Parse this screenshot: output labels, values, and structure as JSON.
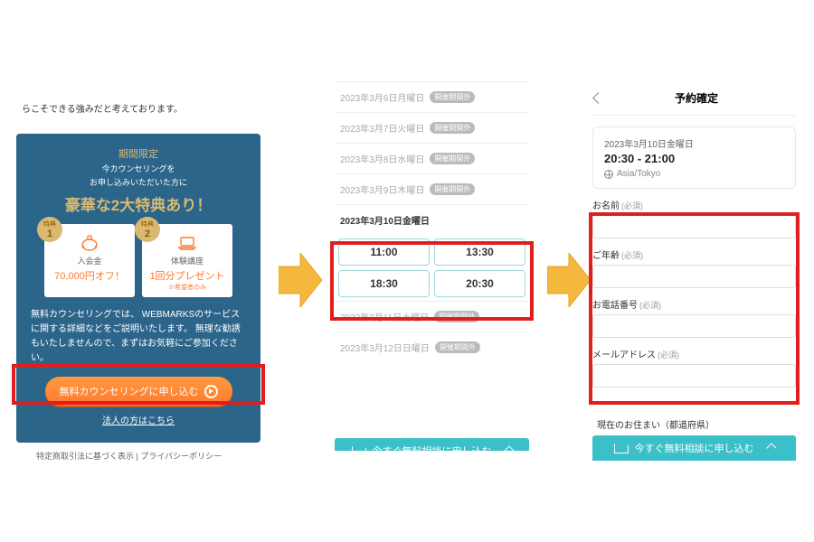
{
  "intro": "らこそできる強みだと考えております。",
  "promo": {
    "eyebrow": "期間限定",
    "sub1": "今カウンセリングを",
    "sub2": "お申し込みいただいた方に",
    "title": "豪華な2大特典あり！",
    "bonus1": {
      "rank": "1",
      "rank_label": "特典",
      "label": "入会金",
      "main": "70,000円オフ！"
    },
    "bonus2": {
      "rank": "2",
      "rank_label": "特典",
      "label": "体験講座",
      "main": "1回分プレゼント",
      "note": "※希望者のみ"
    },
    "body": "無料カウンセリングでは、\nWEBMARKSのサービスに関する詳細などをご説明いたします。\n無理な勧誘もいたしませんので、まずはお気軽にご参加ください。",
    "cta": "無料カウンセリングに申し込む",
    "corp_link": "法人の方はこちら"
  },
  "footer": {
    "tokusho": "特定商取引法に基づく表示",
    "sep": " | ",
    "privacy": "プライバシーポリシー"
  },
  "calendar": {
    "days": [
      {
        "label": "2023年3月6日月曜日",
        "chip": "開催期間外"
      },
      {
        "label": "2023年3月7日火曜日",
        "chip": "開催期間外"
      },
      {
        "label": "2023年3月8日水曜日",
        "chip": "開催期間外"
      },
      {
        "label": "2023年3月9日木曜日",
        "chip": "開催期間外"
      },
      {
        "label": "2023年3月10日金曜日"
      },
      {
        "label": "2023年3月11日土曜日",
        "chip": "開催期間外"
      },
      {
        "label": "2023年3月12日日曜日",
        "chip": "開催期間外"
      }
    ],
    "slots": [
      "11:00",
      "13:30",
      "18:30",
      "20:30"
    ]
  },
  "fixed_cta": "今すぐ無料相談に申し込む",
  "form": {
    "title": "予約確定",
    "date": "2023年3月10日金曜日",
    "time": "20:30 - 21:00",
    "tz": "Asia/Tokyo",
    "fields": {
      "name": {
        "label": "お名前",
        "req": "(必須)"
      },
      "age": {
        "label": "ご年齢",
        "req": "(必須)"
      },
      "phone": {
        "label": "お電話番号",
        "req": "(必須)"
      },
      "email": {
        "label": "メールアドレス",
        "req": "(必須)"
      },
      "pref": {
        "label": "現在のお住まい（都道府県）"
      }
    }
  }
}
